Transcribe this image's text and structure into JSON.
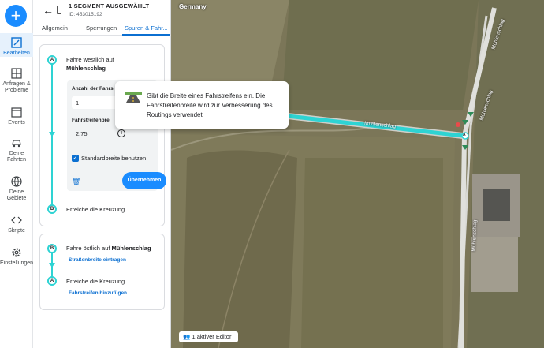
{
  "rail": {
    "add_label": "+",
    "items": [
      {
        "label": "Bearbeiten",
        "icon": "edit-map-icon"
      },
      {
        "label": "Anfragen & Probleme",
        "icon": "grid-icon"
      },
      {
        "label": "Events",
        "icon": "calendar-icon"
      },
      {
        "label": "Deine Fahrten",
        "icon": "car-icon"
      },
      {
        "label": "Deine Gebiete",
        "icon": "globe-icon"
      },
      {
        "label": "Skripte",
        "icon": "code-icon"
      },
      {
        "label": "Einstellungen",
        "icon": "gear-icon"
      }
    ]
  },
  "header": {
    "title": "1 SEGMENT AUSGEWÄHLT",
    "id": "ID: 453015192"
  },
  "tabs": [
    "Allgemein",
    "Sperrungen",
    "Spuren & Fahr..."
  ],
  "direction_west": {
    "start_node": "A",
    "end_node": "B",
    "title_prefix": "Fahre westlich auf",
    "street": "Mühlenschlag",
    "lanes_label": "Anzahl der Fahrs",
    "lanes_value": "1",
    "width_label": "Fahrstreifenbrei",
    "width_value": "2.75",
    "default_width_label": "Standardbreite benutzen",
    "apply_label": "Übernehmen",
    "end_text": "Erreiche die Kreuzung"
  },
  "direction_east": {
    "start_node": "B",
    "end_node": "A",
    "title_prefix": "Fahre östlich auf",
    "street": "Mühlenschlag",
    "road_width_link": "Straßenbreite eintragen",
    "end_text": "Erreiche die Kreuzung",
    "add_lanes_link": "Fahrstreifen hinzufügen"
  },
  "tooltip": {
    "text": "Gibt die Breite eines Fahrstreifens ein. Die Fahrstreifenbreite wird zur Verbesserung des Routings verwendet"
  },
  "map": {
    "country": "Germany",
    "street_label_1": "Mühlenschlag",
    "street_label_2": "Mühlenschlag",
    "street_label_3": "Mühlenschlag",
    "street_label_4": "Mühlenschlag",
    "node_label": "A",
    "editors": "1 aktiver Editor"
  },
  "colors": {
    "accent": "#1a8cff",
    "segment_highlight": "#2ed3d3"
  }
}
